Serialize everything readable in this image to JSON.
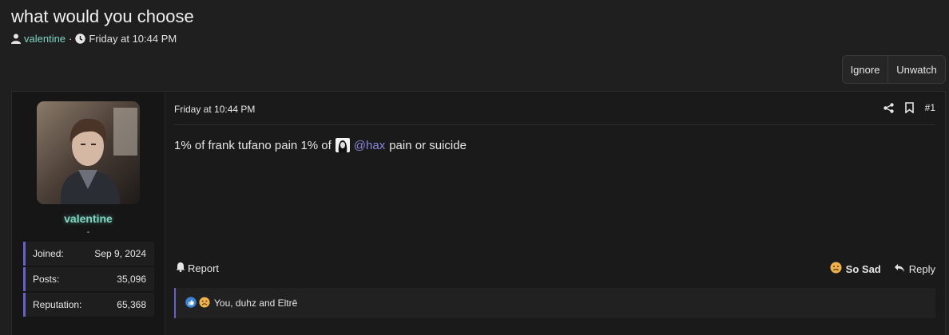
{
  "thread": {
    "title": "what would you choose",
    "author": "valentine",
    "separator": "·",
    "date": "Friday at 10:44 PM"
  },
  "toolbar": {
    "ignore_label": "Ignore",
    "unwatch_label": "Unwatch"
  },
  "post": {
    "user": {
      "name": "valentine",
      "title": "-",
      "stats": [
        {
          "label": "Joined:",
          "value": "Sep 9, 2024"
        },
        {
          "label": "Posts:",
          "value": "35,096"
        },
        {
          "label": "Reputation:",
          "value": "65,368"
        }
      ]
    },
    "date": "Friday at 10:44 PM",
    "number": "#1",
    "message": {
      "before": "1% of frank tufano pain 1% of",
      "mention": "@hax",
      "after": "pain or suicide"
    },
    "report_label": "Report",
    "reaction_label": "So Sad",
    "reply_label": "Reply",
    "reactions_summary": "You, duhz and Eltrē"
  },
  "colors": {
    "background": "#1f1f1f",
    "username": "#7fd4c1",
    "mention": "#8a86e0",
    "accent_bar": "#6a5fc8"
  },
  "icons": [
    "user-icon",
    "clock-icon",
    "share-icon",
    "bookmark-icon",
    "bell-icon",
    "sad-face-icon",
    "reply-icon",
    "like-icon"
  ]
}
